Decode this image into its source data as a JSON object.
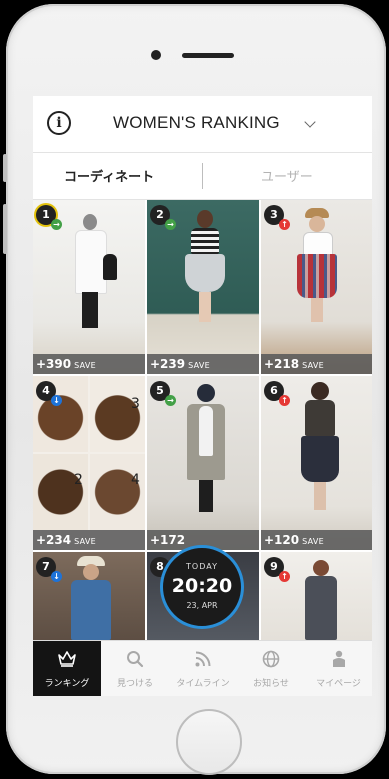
{
  "header": {
    "title": "WOMEN'S RANKING"
  },
  "tabs": {
    "active": "コーディネート",
    "inactive": "ユーザー"
  },
  "tiles": [
    {
      "rank": "1",
      "trend": "flat",
      "save": "+390",
      "save_label": "SAVE"
    },
    {
      "rank": "2",
      "trend": "flat",
      "save": "+239",
      "save_label": "SAVE"
    },
    {
      "rank": "3",
      "trend": "up",
      "save": "+218",
      "save_label": "SAVE"
    },
    {
      "rank": "4",
      "trend": "down",
      "save": "+234",
      "save_label": "SAVE"
    },
    {
      "rank": "5",
      "trend": "flat",
      "save": "+172",
      "save_label": ""
    },
    {
      "rank": "6",
      "trend": "up",
      "save": "+120",
      "save_label": "SAVE"
    },
    {
      "rank": "7",
      "trend": "down",
      "save": "",
      "save_label": ""
    },
    {
      "rank": "8",
      "trend": "",
      "save": "",
      "save_label": ""
    },
    {
      "rank": "9",
      "trend": "up",
      "save": "",
      "save_label": ""
    }
  ],
  "collage_numbers": [
    "3",
    "2",
    "4"
  ],
  "clock": {
    "today": "TODAY",
    "time": "20:20",
    "date": "23, APR"
  },
  "nav": [
    {
      "label": "ランキング",
      "icon": "crown-icon"
    },
    {
      "label": "見つける",
      "icon": "search-icon"
    },
    {
      "label": "タイムライン",
      "icon": "rss-icon"
    },
    {
      "label": "お知らせ",
      "icon": "globe-icon"
    },
    {
      "label": "マイページ",
      "icon": "person-icon"
    }
  ],
  "colors": {
    "accent_blue": "#2a8fd8",
    "rank_up": "#e53935",
    "rank_flat": "#43a047",
    "rank_down": "#1e73d8"
  }
}
